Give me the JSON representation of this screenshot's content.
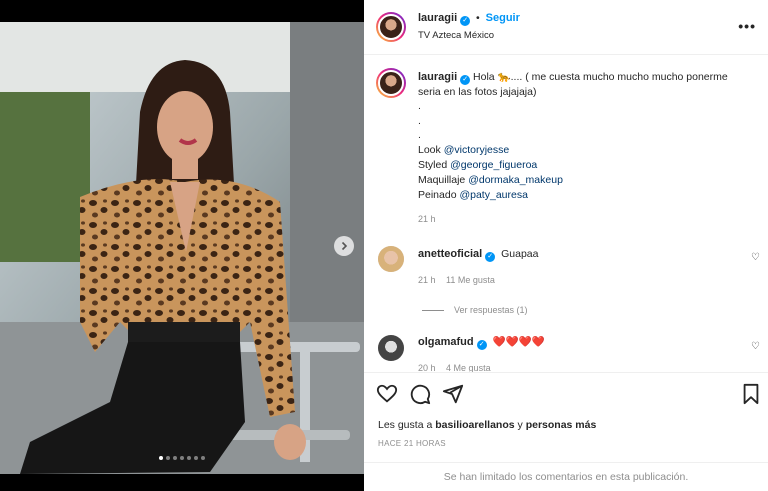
{
  "post": {
    "author": "lauragii",
    "follow_label": "Seguir",
    "separator": "•",
    "location": "TV Azteca México",
    "more_label": "•••"
  },
  "caption": {
    "author": "lauragii",
    "line1": "Hola 🐆.... ( me cuesta mucho mucho mucho ponerme",
    "line2": "seria en las fotos jajajaja)",
    "dot1": ".",
    "dot2": ".",
    "dot3": ".",
    "look_label": "Look",
    "look_mention": "@victoryjesse",
    "styled_label": "Styled",
    "styled_mention": "@george_figueroa",
    "makeup_label": "Maquillaje",
    "makeup_mention": "@dormaka_makeup",
    "hair_label": "Peinado",
    "hair_mention": "@paty_auresa",
    "time": "21 h"
  },
  "comments": [
    {
      "user": "anetteoficial",
      "text": "Guapaa",
      "time": "21 h",
      "likes": "11 Me gusta"
    },
    {
      "user": "olgamafud",
      "text": "❤️❤️❤️❤️",
      "time": "20 h",
      "likes": "4 Me gusta"
    }
  ],
  "view_replies": "Ver respuestas (1)",
  "likes_prefix": "Les gusta a",
  "likes_user": "basilioarellanos",
  "likes_join": "y",
  "likes_others": "personas más",
  "posted_ago": "HACE 21 HORAS",
  "comments_limited": "Se han limitado los comentarios en esta publicación.",
  "carousel": {
    "total_dots": 7,
    "active_index": 0
  },
  "colors": {
    "accent": "#0095f6",
    "mention": "#00376b",
    "muted": "#8e8e8e"
  },
  "icons": [
    "chevron-right-icon",
    "heart-icon",
    "comment-icon",
    "share-icon",
    "bookmark-icon",
    "verified-icon",
    "more-icon"
  ]
}
